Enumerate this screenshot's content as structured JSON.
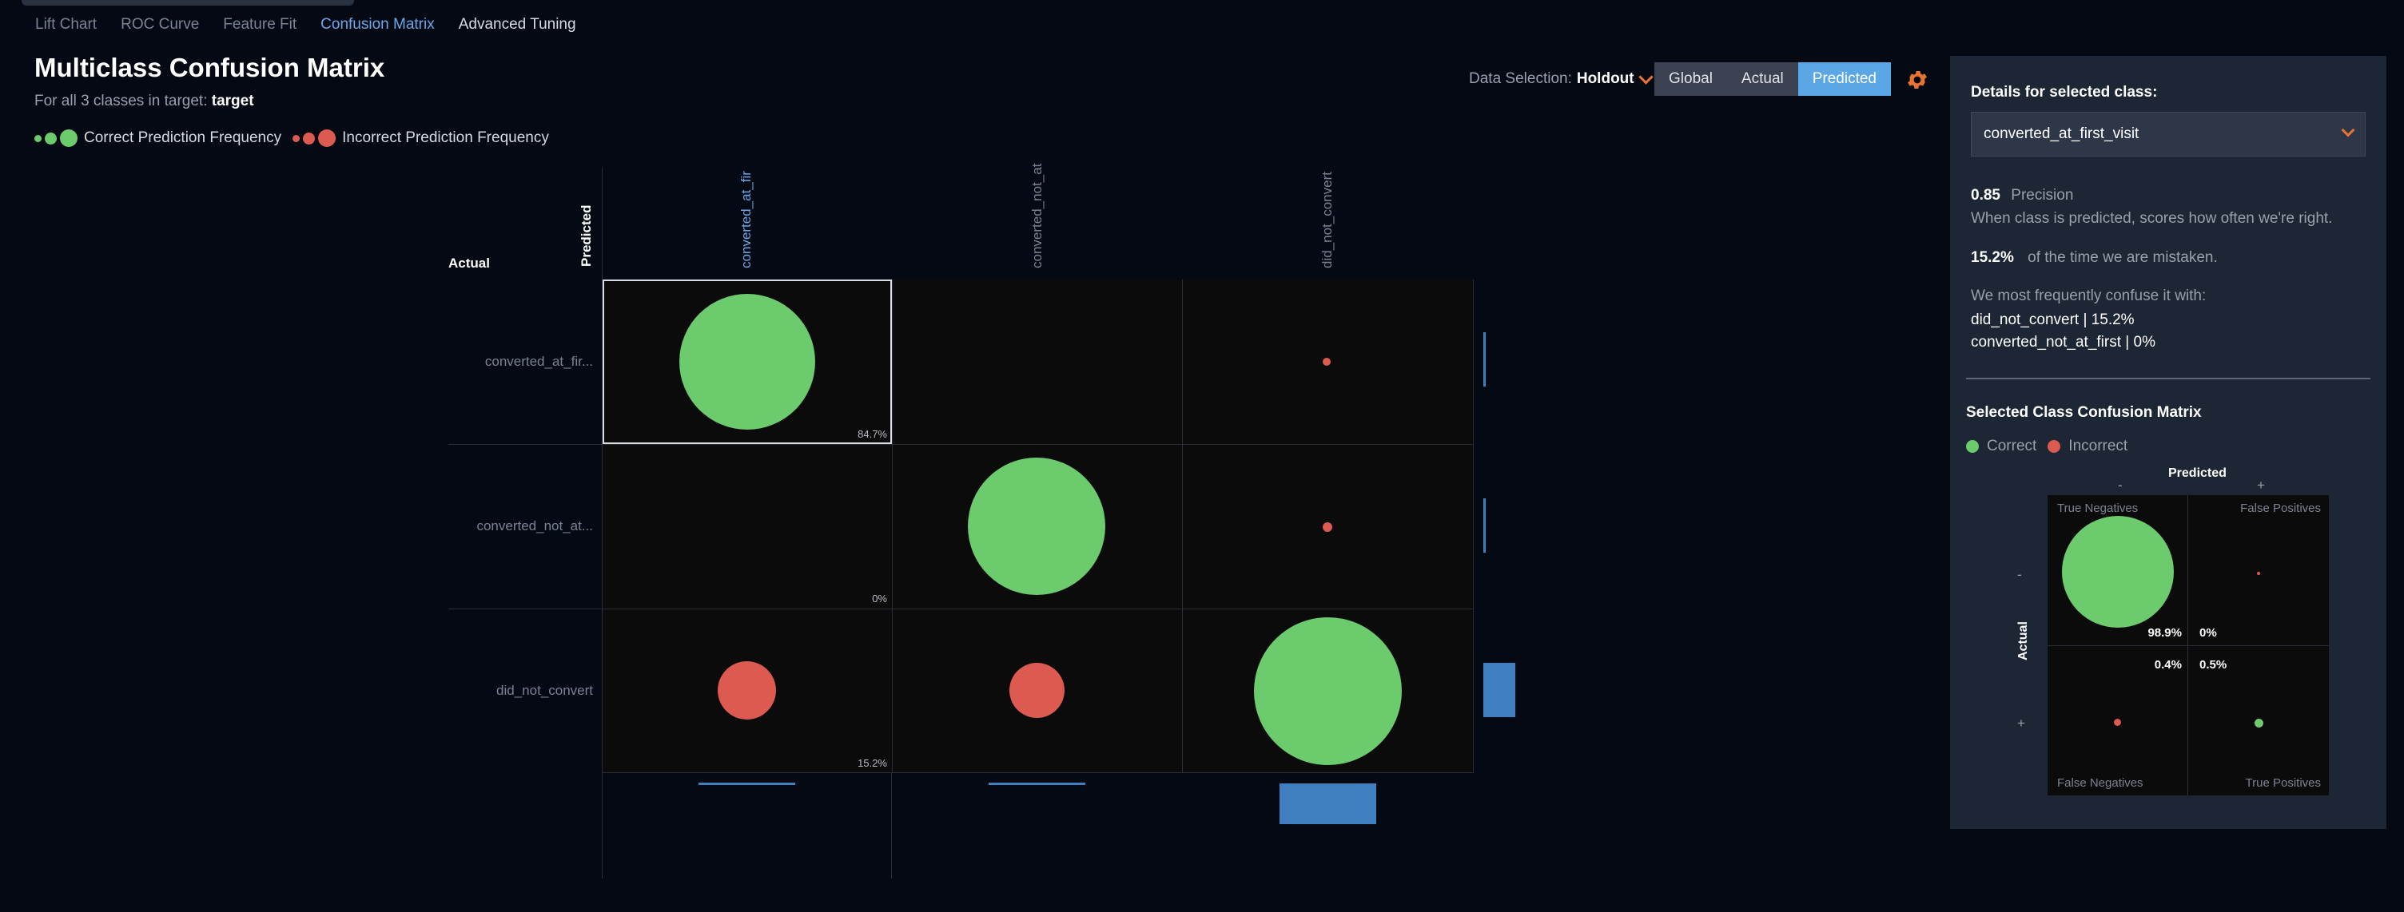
{
  "tabs": [
    {
      "label": "Lift Chart"
    },
    {
      "label": "ROC Curve"
    },
    {
      "label": "Feature Fit"
    },
    {
      "label": "Confusion Matrix"
    },
    {
      "label": "Advanced Tuning"
    }
  ],
  "header": {
    "title": "Multiclass Confusion Matrix",
    "subtitle_prefix": "For all 3 classes in target:",
    "target": "target"
  },
  "legend": {
    "correct": "Correct Prediction Frequency",
    "incorrect": "Incorrect Prediction Frequency"
  },
  "data_selection": {
    "label": "Data Selection:",
    "value": "Holdout"
  },
  "view_toggle": {
    "global": "Global",
    "actual": "Actual",
    "predicted": "Predicted",
    "selected": "Predicted"
  },
  "matrix": {
    "actual_axis_label": "Actual",
    "predicted_axis_label": "Predicted",
    "col_labels": [
      "converted_at_fir",
      "converted_not_at",
      "did_not_convert"
    ],
    "row_labels": [
      "converted_at_fir...",
      "converted_not_at...",
      "did_not_convert"
    ],
    "row_pct": [
      "84.7%",
      "0%",
      "15.2%"
    ]
  },
  "details": {
    "heading": "Details for selected class:",
    "selected_class": "converted_at_first_visit",
    "precision_value": "0.85",
    "precision_label": "Precision",
    "precision_desc": "When class is predicted, scores how often we're right.",
    "mistaken_value": "15.2%",
    "mistaken_label": "of the time we are mistaken.",
    "confuse_heading": "We most frequently confuse it with:",
    "confuse_items": [
      "did_not_convert | 15.2%",
      "converted_not_at_first | 0%"
    ]
  },
  "selected_matrix": {
    "heading": "Selected Class Confusion Matrix",
    "legend_correct": "Correct",
    "legend_incorrect": "Incorrect",
    "predicted_label": "Predicted",
    "actual_label": "Actual",
    "minus": "-",
    "plus": "+",
    "tn": "True Negatives",
    "fp": "False Positives",
    "fn": "False Negatives",
    "tp": "True Positives",
    "tn_pct": "98.9%",
    "fp_pct": "0%",
    "fn_pct": "0.4%",
    "tp_pct": "0.5%"
  },
  "colors": {
    "correct": "#6ccb6c",
    "incorrect": "#dc5a4f",
    "accent": "#5ba7e6",
    "bar": "#3f7fbf"
  }
}
